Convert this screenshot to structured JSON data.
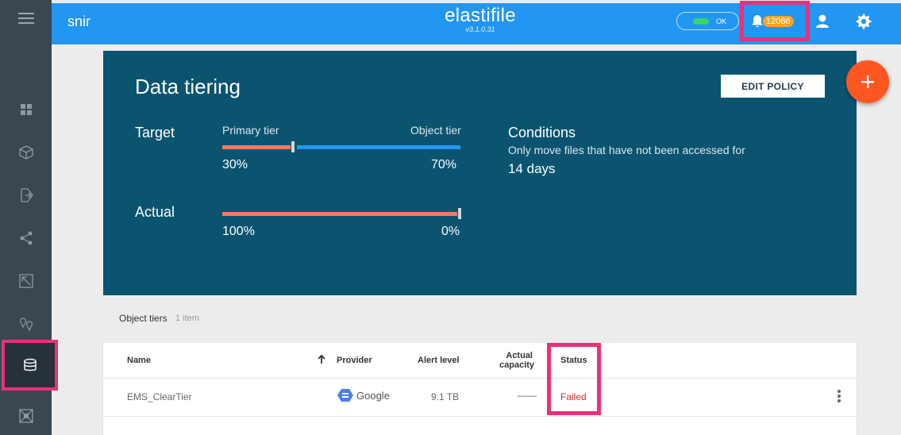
{
  "header": {
    "account": "snir",
    "logo": "elastifile",
    "version": "v3.1.0.31",
    "status_label": "OK",
    "alert_count": "12086"
  },
  "sidebar": {
    "items": [
      {
        "icon": "dashboard-icon"
      },
      {
        "icon": "cube-icon"
      },
      {
        "icon": "export-icon"
      },
      {
        "icon": "share-icon"
      },
      {
        "icon": "snapshot-icon"
      },
      {
        "icon": "locations-icon"
      },
      {
        "icon": "data-tiering-icon",
        "active": true
      },
      {
        "icon": "cluster-icon"
      }
    ]
  },
  "panel": {
    "title": "Data tiering",
    "edit_button": "EDIT POLICY",
    "target_label": "Target",
    "actual_label": "Actual",
    "primary_tier_label": "Primary tier",
    "object_tier_label": "Object tier",
    "target_primary_pct": "30%",
    "target_object_pct": "70%",
    "actual_primary_pct": "100%",
    "actual_object_pct": "0%",
    "target_primary_fraction": 0.3,
    "actual_primary_fraction": 1.0,
    "conditions_title": "Conditions",
    "conditions_desc": "Only move files that have not been accessed for",
    "conditions_days": "14 days"
  },
  "object_tiers": {
    "title": "Object tiers",
    "count": "1 item",
    "columns": {
      "name": "Name",
      "provider": "Provider",
      "alert_level": "Alert level",
      "actual_capacity_line1": "Actual",
      "actual_capacity_line2": "capacity",
      "status": "Status"
    },
    "rows": [
      {
        "name": "EMS_ClearTier",
        "provider": "Google",
        "alert_level": "9.1 TB",
        "actual_capacity": "——",
        "status": "Failed"
      }
    ]
  },
  "colors": {
    "header": "#2196f3",
    "panel": "#0a5470",
    "sidebar": "#3a4750",
    "highlight": "#e8317a",
    "primary_bar": "#ff7a5c",
    "object_bar": "#2196f3",
    "fab": "#ff5722",
    "failed": "#d32f2f"
  }
}
